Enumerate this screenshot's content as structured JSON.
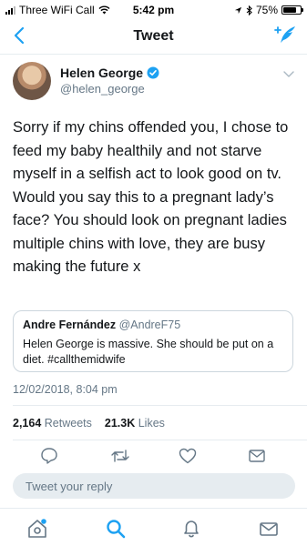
{
  "status_bar": {
    "carrier": "Three WiFi Call",
    "time": "5:42 pm",
    "battery": "75%",
    "battery_level": 0.75
  },
  "nav": {
    "title": "Tweet"
  },
  "tweet": {
    "author_name": "Helen George",
    "author_handle": "@helen_george",
    "verified": true,
    "text": "Sorry if my chins offended you, I chose to feed my baby healthily and not starve myself in a selfish act to look good on tv. Would you say this to a pregnant lady’s face? You should look on pregnant ladies multiple chins with love, they are busy making the future x",
    "quoted": {
      "author_name": "Andre Fernández",
      "author_handle": "@AndreF75",
      "text": "Helen George is massive. She should be put on a diet. #callthemidwife"
    },
    "timestamp": "12/02/2018, 8:04 pm",
    "retweets_count": "2,164",
    "retweets_label": "Retweets",
    "likes_count": "21.3K",
    "likes_label": "Likes"
  },
  "reply": {
    "placeholder": "Tweet your reply"
  },
  "colors": {
    "accent": "#1da1f2",
    "text": "#14171a",
    "secondary": "#657786",
    "border": "#e6ecf0"
  },
  "icons": {
    "back": "chevron-left-icon",
    "compose": "compose-icon",
    "verified": "verified-badge-icon",
    "more": "chevron-down-icon",
    "reply": "reply-icon",
    "retweet": "retweet-icon",
    "like": "heart-icon",
    "dm": "envelope-icon",
    "home": "home-icon",
    "search": "search-icon",
    "notifications": "bell-icon",
    "messages": "envelope-icon"
  }
}
